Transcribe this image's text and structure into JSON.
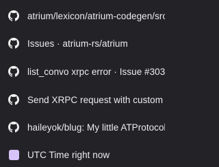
{
  "colors": {
    "background": "#232327",
    "text": "#ececef",
    "icon": "#f2f2f2",
    "favicon_swatch": "#d6c3fa"
  },
  "tabs": [
    {
      "label": "atrium/lexicon/atrium-codegen/src",
      "icon": "github-icon"
    },
    {
      "label": "Issues · atrium-rs/atrium",
      "icon": "github-icon"
    },
    {
      "label": "list_convo xrpc error · Issue #303",
      "icon": "github-icon"
    },
    {
      "label": "Send XRPC request with custom",
      "icon": "github-icon"
    },
    {
      "label": "haileyok/blug: My little ATProtocol",
      "icon": "github-icon"
    },
    {
      "label": "UTC Time right now",
      "icon": "lavender-square-icon"
    }
  ]
}
